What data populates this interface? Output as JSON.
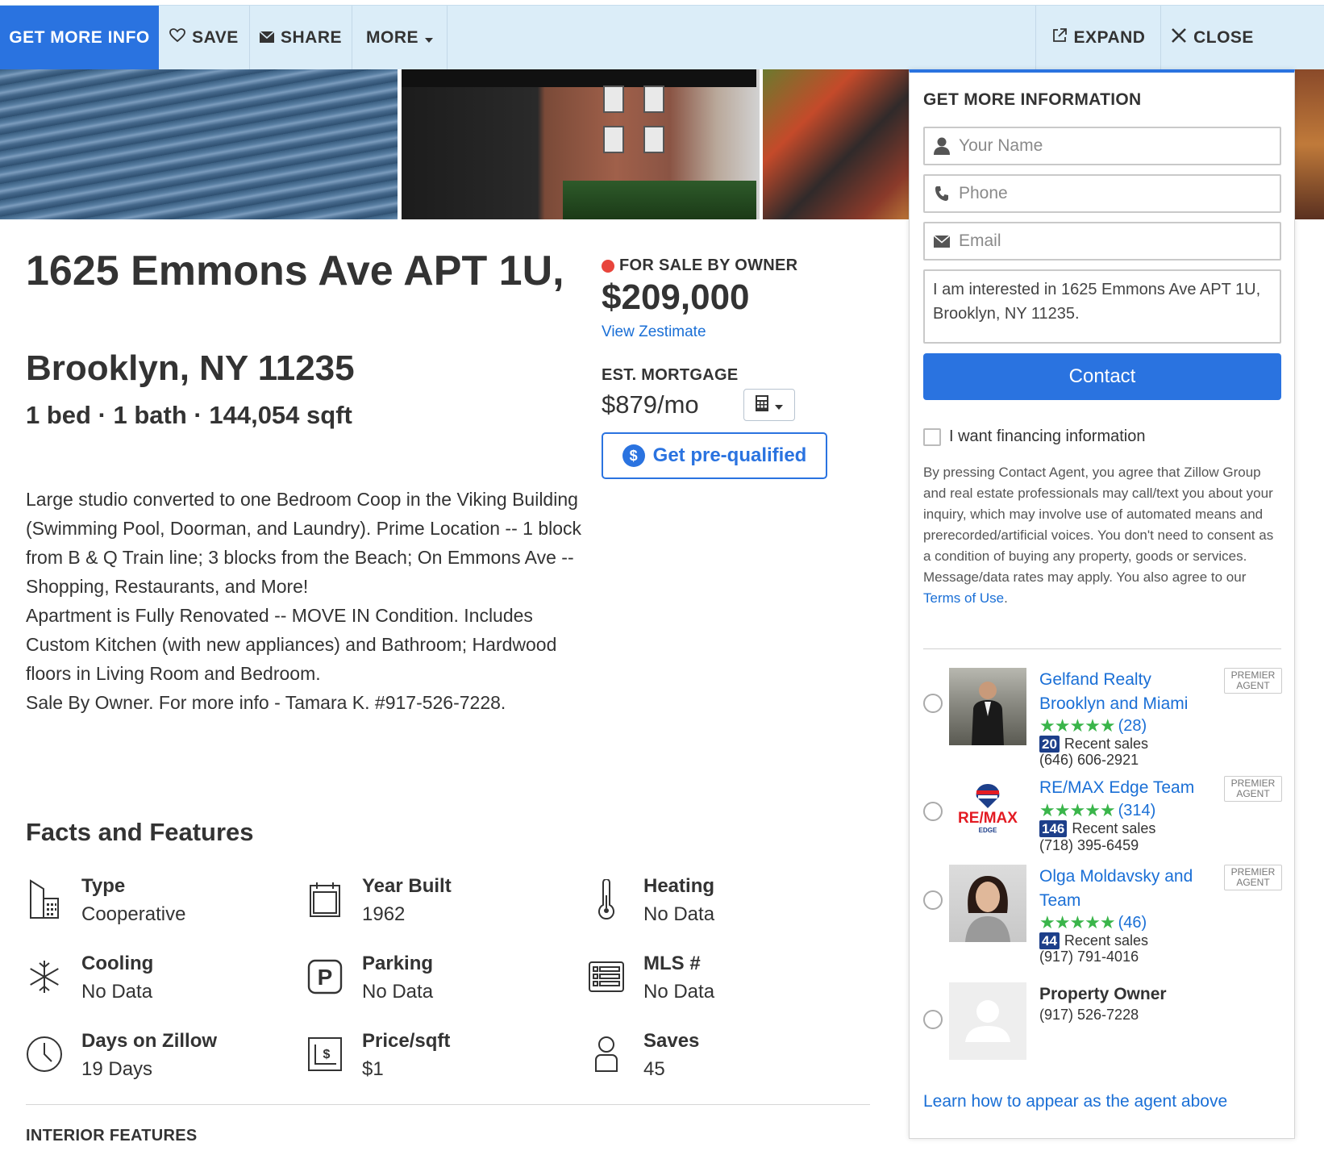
{
  "toolbar": {
    "get_more_info": "GET MORE INFO",
    "save": "SAVE",
    "share": "SHARE",
    "more": "MORE",
    "expand": "EXPAND",
    "close": "CLOSE"
  },
  "listing": {
    "address_line1": "1625 Emmons Ave APT 1U,",
    "address_line2": "Brooklyn, NY 11235",
    "specs": "1 bed · 1 bath · 144,054 sqft",
    "status": "FOR SALE BY OWNER",
    "price": "$209,000",
    "zestimate_link": "View Zestimate",
    "mortgage_label": "EST. MORTGAGE",
    "mortgage_value": "$879/mo",
    "prequalify_label": "Get pre-qualified",
    "description": [
      "Large studio converted to one Bedroom Coop in the Viking Building (Swimming Pool, Doorman, and Laundry). Prime Location -- 1 block from B & Q Train line; 3 blocks from the Beach; On Emmons Ave -- Shopping, Restaurants, and More!",
      "Apartment is Fully Renovated -- MOVE IN Condition. Includes Custom Kitchen (with new appliances) and Bathroom; Hardwood floors in Living Room and Bedroom.",
      "Sale By Owner. For more info - Tamara K. #917-526-7228."
    ]
  },
  "facts": {
    "title": "Facts and Features",
    "items": [
      {
        "label": "Type",
        "value": "Cooperative",
        "icon": "building-icon"
      },
      {
        "label": "Year Built",
        "value": "1962",
        "icon": "calendar-icon"
      },
      {
        "label": "Heating",
        "value": "No Data",
        "icon": "thermometer-icon"
      },
      {
        "label": "Cooling",
        "value": "No Data",
        "icon": "snowflake-icon"
      },
      {
        "label": "Parking",
        "value": "No Data",
        "icon": "parking-icon"
      },
      {
        "label": "MLS #",
        "value": "No Data",
        "icon": "list-icon"
      },
      {
        "label": "Days on Zillow",
        "value": "19 Days",
        "icon": "clock-icon"
      },
      {
        "label": "Price/sqft",
        "value": "$1",
        "icon": "price-sqft-icon"
      },
      {
        "label": "Saves",
        "value": "45",
        "icon": "person-icon"
      }
    ],
    "interior_heading": "INTERIOR FEATURES"
  },
  "panel": {
    "title": "GET MORE INFORMATION",
    "name_placeholder": "Your Name",
    "phone_placeholder": "Phone",
    "email_placeholder": "Email",
    "message": "I am interested in 1625 Emmons Ave APT 1U, Brooklyn, NY 11235.",
    "contact_button": "Contact",
    "financing_label": "I want financing information",
    "legal_text": "By pressing Contact Agent, you agree that Zillow Group and real estate professionals may call/text you about your inquiry, which may involve use of automated means and prerecorded/artificial voices. You don't need to consent as a condition of buying any property, goods or services. Message/data rates may apply. You also agree to our",
    "terms_link": "Terms of Use",
    "terms_suffix": ".",
    "premier_badge": "PREMIER AGENT",
    "recent_sales_label": "Recent sales",
    "agents": [
      {
        "name": "Gelfand Realty Brooklyn and Miami",
        "reviews": "(28)",
        "rating": 5,
        "sales": "20",
        "phone": "(646) 606-2921"
      },
      {
        "name": "RE/MAX Edge Team",
        "reviews": "(314)",
        "rating": 5,
        "sales": "146",
        "phone": "(718) 395-6459"
      },
      {
        "name": "Olga Moldavsky and Team",
        "reviews": "(46)",
        "rating": 5,
        "sales": "44",
        "phone": "(917) 791-4016"
      }
    ],
    "owner": {
      "name": "Property Owner",
      "phone": "(917) 526-7228"
    },
    "logo_text": "RE/MAX",
    "logo_subtext": "EDGE",
    "learn_link": "Learn how to appear as the agent above"
  },
  "colors": {
    "accent": "#2a73e0",
    "toolbar_bg": "#dbedf8",
    "status_dot": "#e8453c",
    "stars": "#3ab54a",
    "sales_badge": "#1d3f8a"
  }
}
